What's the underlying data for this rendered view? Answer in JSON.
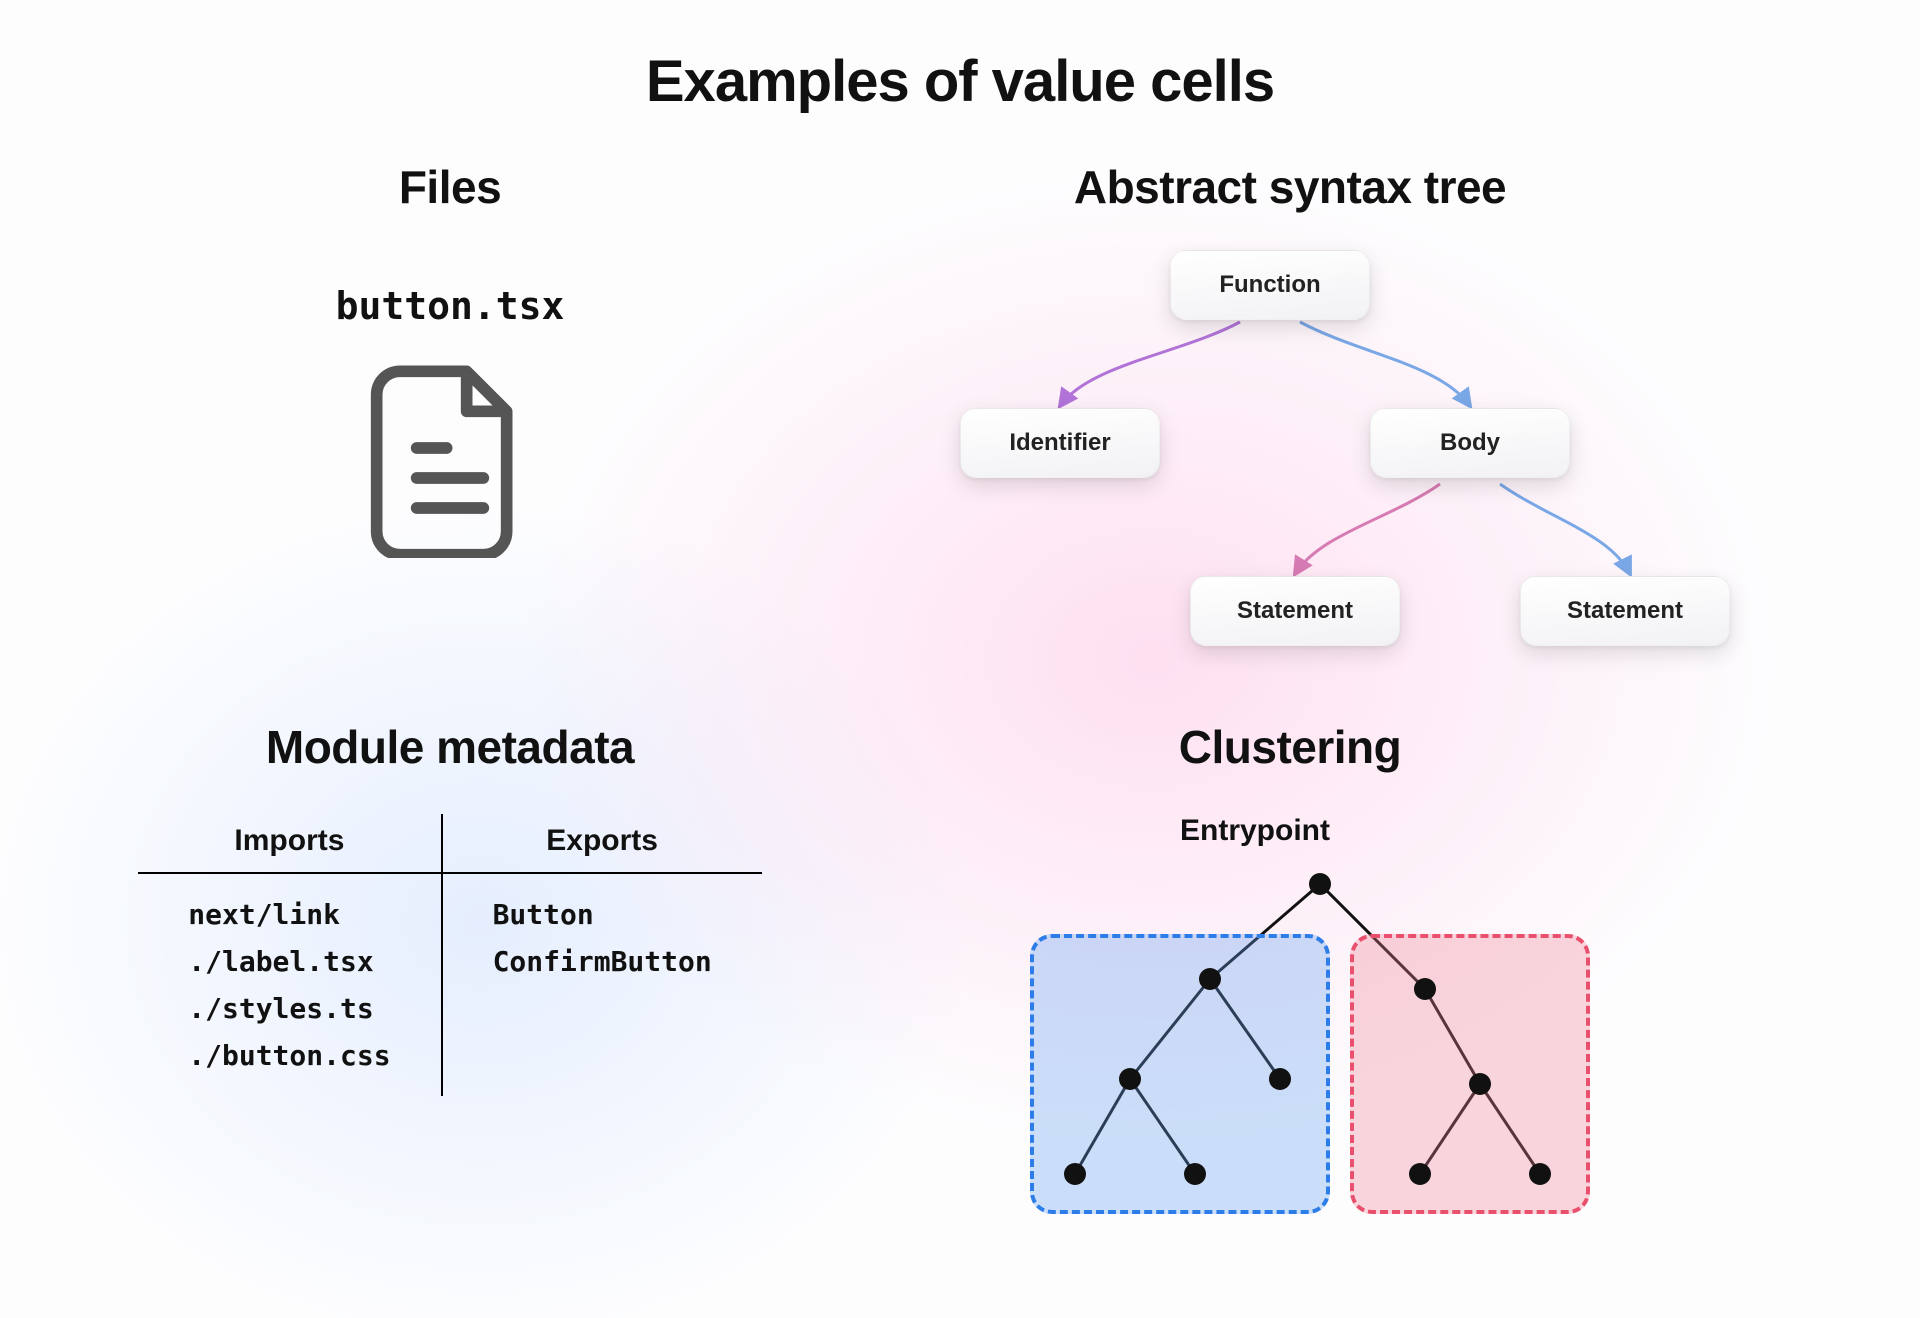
{
  "title": "Examples of value cells",
  "files": {
    "heading": "Files",
    "filename": "button.tsx"
  },
  "ast": {
    "heading": "Abstract syntax tree",
    "nodes": {
      "root": "Function",
      "left": "Identifier",
      "right": "Body",
      "leaf1": "Statement",
      "leaf2": "Statement"
    }
  },
  "metadata": {
    "heading": "Module metadata",
    "imports_header": "Imports",
    "exports_header": "Exports",
    "imports": [
      "next/link",
      "./label.tsx",
      "./styles.ts",
      "./button.css"
    ],
    "exports": [
      "Button",
      "ConfirmButton"
    ]
  },
  "clustering": {
    "heading": "Clustering",
    "entry_label": "Entrypoint"
  }
}
